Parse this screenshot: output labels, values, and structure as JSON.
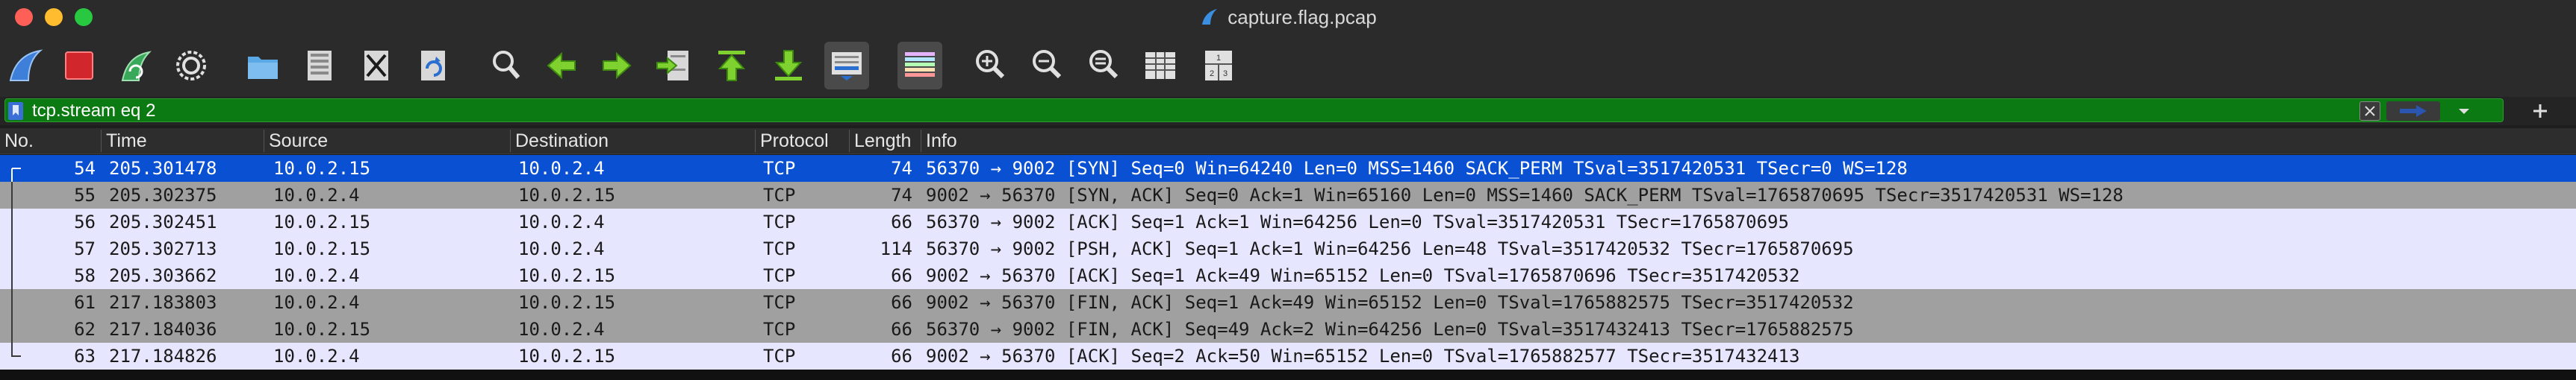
{
  "window": {
    "title": "capture.flag.pcap"
  },
  "filter": {
    "value": "tcp.stream eq 2"
  },
  "columns": [
    "No.",
    "Time",
    "Source",
    "Destination",
    "Protocol",
    "Length",
    "Info"
  ],
  "packets": [
    {
      "no": "54",
      "time": "205.301478",
      "src": "10.0.2.15",
      "dst": "10.0.2.4",
      "proto": "TCP",
      "len": "74",
      "info": "56370 → 9002 [SYN] Seq=0 Win=64240 Len=0 MSS=1460 SACK_PERM TSval=3517420531 TSecr=0 WS=128"
    },
    {
      "no": "55",
      "time": "205.302375",
      "src": "10.0.2.4",
      "dst": "10.0.2.15",
      "proto": "TCP",
      "len": "74",
      "info": "9002 → 56370 [SYN, ACK] Seq=0 Ack=1 Win=65160 Len=0 MSS=1460 SACK_PERM TSval=1765870695 TSecr=3517420531 WS=128"
    },
    {
      "no": "56",
      "time": "205.302451",
      "src": "10.0.2.15",
      "dst": "10.0.2.4",
      "proto": "TCP",
      "len": "66",
      "info": "56370 → 9002 [ACK] Seq=1 Ack=1 Win=64256 Len=0 TSval=3517420531 TSecr=1765870695"
    },
    {
      "no": "57",
      "time": "205.302713",
      "src": "10.0.2.15",
      "dst": "10.0.2.4",
      "proto": "TCP",
      "len": "114",
      "info": "56370 → 9002 [PSH, ACK] Seq=1 Ack=1 Win=64256 Len=48 TSval=3517420532 TSecr=1765870695"
    },
    {
      "no": "58",
      "time": "205.303662",
      "src": "10.0.2.4",
      "dst": "10.0.2.15",
      "proto": "TCP",
      "len": "66",
      "info": "9002 → 56370 [ACK] Seq=1 Ack=49 Win=65152 Len=0 TSval=1765870696 TSecr=3517420532"
    },
    {
      "no": "61",
      "time": "217.183803",
      "src": "10.0.2.4",
      "dst": "10.0.2.15",
      "proto": "TCP",
      "len": "66",
      "info": "9002 → 56370 [FIN, ACK] Seq=1 Ack=49 Win=65152 Len=0 TSval=1765882575 TSecr=3517420532"
    },
    {
      "no": "62",
      "time": "217.184036",
      "src": "10.0.2.15",
      "dst": "10.0.2.4",
      "proto": "TCP",
      "len": "66",
      "info": "56370 → 9002 [FIN, ACK] Seq=49 Ack=2 Win=64256 Len=0 TSval=3517432413 TSecr=1765882575"
    },
    {
      "no": "63",
      "time": "217.184826",
      "src": "10.0.2.4",
      "dst": "10.0.2.15",
      "proto": "TCP",
      "len": "66",
      "info": "9002 → 56370 [ACK] Seq=2 Ack=50 Win=65152 Len=0 TSval=1765882577 TSecr=3517432413"
    }
  ],
  "row_styles": [
    "selected",
    "gray",
    "light",
    "light",
    "light",
    "gray",
    "gray",
    "light"
  ],
  "colors": {
    "selected_row": "#0a50d2",
    "tcp_row": "#e7e6ff",
    "fin_syn_row": "#a0a0a0",
    "filter_valid": "#0b7a12"
  },
  "toolbar_icons": [
    "shark-fin-start-icon",
    "stop-capture-icon",
    "restart-capture-icon",
    "capture-options-gear-icon",
    "open-folder-icon",
    "save-file-icon",
    "close-file-icon",
    "reload-icon",
    "find-packet-icon",
    "go-back-icon",
    "go-forward-icon",
    "go-to-packet-icon",
    "first-packet-icon",
    "last-packet-icon",
    "autoscroll-icon",
    "colorize-icon",
    "zoom-in-icon",
    "zoom-out-icon",
    "normal-size-icon",
    "resize-columns-icon",
    "layout-icon"
  ]
}
